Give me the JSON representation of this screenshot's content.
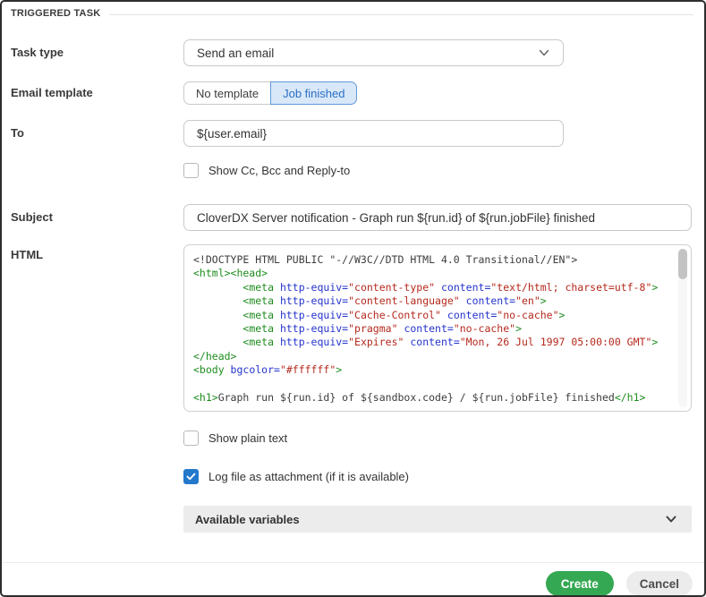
{
  "header": {
    "title": "TRIGGERED TASK"
  },
  "form": {
    "task_type": {
      "label": "Task type",
      "value": "Send an email"
    },
    "email_template": {
      "label": "Email template",
      "options": [
        "No template",
        "Job finished"
      ],
      "selected": "Job finished"
    },
    "to": {
      "label": "To",
      "value": "${user.email}"
    },
    "show_cc": {
      "label": "Show Cc, Bcc and Reply-to",
      "checked": false
    },
    "subject": {
      "label": "Subject",
      "value": "CloverDX Server notification - Graph run ${run.id} of ${run.jobFile} finished"
    },
    "html": {
      "label": "HTML"
    },
    "show_plain_text": {
      "label": "Show plain text",
      "checked": false
    },
    "log_attachment": {
      "label": "Log file as attachment (if it is available)",
      "checked": true
    },
    "available_variables": {
      "label": "Available variables"
    }
  },
  "code": {
    "lines": [
      [
        {
          "t": "<!DOCTYPE HTML PUBLIC \"-//W3C//DTD HTML 4.0 Transitional//EN\">",
          "c": "plain"
        }
      ],
      [
        {
          "t": "<html><head>",
          "c": "tag"
        }
      ],
      [
        {
          "t": "        ",
          "c": "plain"
        },
        {
          "t": "<meta ",
          "c": "tag"
        },
        {
          "t": "http-equiv=",
          "c": "attr"
        },
        {
          "t": "\"content-type\"",
          "c": "str"
        },
        {
          "t": " ",
          "c": "plain"
        },
        {
          "t": "content=",
          "c": "attr"
        },
        {
          "t": "\"text/html; charset=utf-8\"",
          "c": "str"
        },
        {
          "t": ">",
          "c": "tag"
        }
      ],
      [
        {
          "t": "        ",
          "c": "plain"
        },
        {
          "t": "<meta ",
          "c": "tag"
        },
        {
          "t": "http-equiv=",
          "c": "attr"
        },
        {
          "t": "\"content-language\"",
          "c": "str"
        },
        {
          "t": " ",
          "c": "plain"
        },
        {
          "t": "content=",
          "c": "attr"
        },
        {
          "t": "\"en\"",
          "c": "str"
        },
        {
          "t": ">",
          "c": "tag"
        }
      ],
      [
        {
          "t": "        ",
          "c": "plain"
        },
        {
          "t": "<meta ",
          "c": "tag"
        },
        {
          "t": "http-equiv=",
          "c": "attr"
        },
        {
          "t": "\"Cache-Control\"",
          "c": "str"
        },
        {
          "t": " ",
          "c": "plain"
        },
        {
          "t": "content=",
          "c": "attr"
        },
        {
          "t": "\"no-cache\"",
          "c": "str"
        },
        {
          "t": ">",
          "c": "tag"
        }
      ],
      [
        {
          "t": "        ",
          "c": "plain"
        },
        {
          "t": "<meta ",
          "c": "tag"
        },
        {
          "t": "http-equiv=",
          "c": "attr"
        },
        {
          "t": "\"pragma\"",
          "c": "str"
        },
        {
          "t": " ",
          "c": "plain"
        },
        {
          "t": "content=",
          "c": "attr"
        },
        {
          "t": "\"no-cache\"",
          "c": "str"
        },
        {
          "t": ">",
          "c": "tag"
        }
      ],
      [
        {
          "t": "        ",
          "c": "plain"
        },
        {
          "t": "<meta ",
          "c": "tag"
        },
        {
          "t": "http-equiv=",
          "c": "attr"
        },
        {
          "t": "\"Expires\"",
          "c": "str"
        },
        {
          "t": " ",
          "c": "plain"
        },
        {
          "t": "content=",
          "c": "attr"
        },
        {
          "t": "\"Mon, 26 Jul 1997 05:00:00 GMT\"",
          "c": "str"
        },
        {
          "t": ">",
          "c": "tag"
        }
      ],
      [
        {
          "t": "</head>",
          "c": "tag"
        }
      ],
      [
        {
          "t": "<body ",
          "c": "tag"
        },
        {
          "t": "bgcolor=",
          "c": "attr"
        },
        {
          "t": "\"#ffffff\"",
          "c": "str"
        },
        {
          "t": ">",
          "c": "tag"
        }
      ],
      [],
      [
        {
          "t": "<h1>",
          "c": "tag"
        },
        {
          "t": "Graph run ${run.id} of ${sandbox.code} / ${run.jobFile} finished",
          "c": "plain"
        },
        {
          "t": "</h1>",
          "c": "tag"
        }
      ]
    ]
  },
  "footer": {
    "create_label": "Create",
    "cancel_label": "Cancel"
  },
  "colors": {
    "accent_green": "#35a853",
    "accent_blue": "#2478cc",
    "selected_segment_bg": "#d9e8f9",
    "code_tag": "#1e8c1e",
    "code_attr": "#2433cc",
    "code_string": "#b5291d"
  }
}
